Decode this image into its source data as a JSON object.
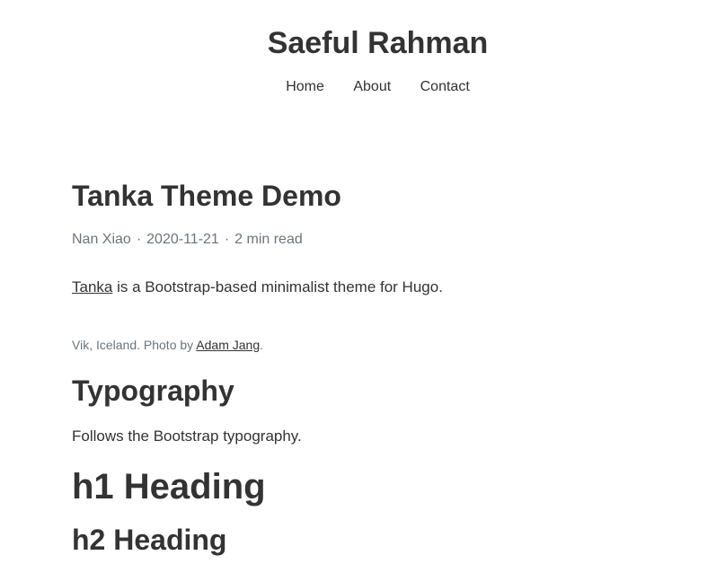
{
  "site": {
    "title": "Saeful Rahman"
  },
  "nav": {
    "items": [
      "Home",
      "About",
      "Contact"
    ]
  },
  "post": {
    "title": "Tanka Theme Demo",
    "author": "Nan Xiao",
    "date": "2020-11-21",
    "read_time": "2 min read",
    "separator": "·",
    "intro_link": "Tanka",
    "intro_rest": " is a Bootstrap-based minimalist theme for Hugo.",
    "caption_prefix": "Vik, Iceland. Photo by ",
    "caption_link": "Adam Jang",
    "caption_suffix": ".",
    "section_heading": "Typography",
    "section_text": "Follows the Bootstrap typography.",
    "h1_demo": "h1 Heading",
    "h2_demo": "h2 Heading"
  }
}
